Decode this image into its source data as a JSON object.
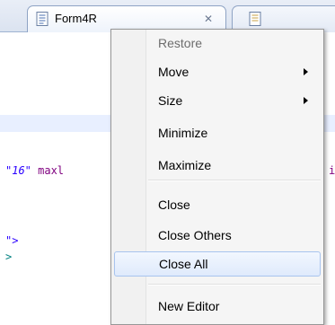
{
  "tabs": [
    {
      "label": "Form4R",
      "icon": "file-icon",
      "close_glyph": "✕"
    },
    {
      "label": "",
      "icon": "file-icon"
    }
  ],
  "editor": {
    "line1": {
      "string": "\"16\"",
      "attr": " maxl",
      "tail": "i"
    },
    "line2": "\">",
    "line3": ">"
  },
  "context_menu": {
    "items": [
      {
        "label": "Restore",
        "enabled": false,
        "submenu": false
      },
      {
        "label": "Move",
        "enabled": true,
        "submenu": true
      },
      {
        "label": "Size",
        "enabled": true,
        "submenu": true
      },
      {
        "label": "Minimize",
        "enabled": true,
        "submenu": false
      },
      {
        "label": "Maximize",
        "enabled": true,
        "submenu": false
      },
      {
        "label": "Close",
        "enabled": true,
        "submenu": false
      },
      {
        "label": "Close Others",
        "enabled": true,
        "submenu": false
      },
      {
        "label": "Close All",
        "enabled": true,
        "submenu": false,
        "highlighted": true
      },
      {
        "label": "New Editor",
        "enabled": true,
        "submenu": false
      }
    ]
  },
  "colors": {
    "menu_bg": "#f5f5f5",
    "hover_border": "#a8c4ee",
    "string": "#2a00ff",
    "attribute": "#7f007f",
    "tag": "#008080",
    "current_line": "#e8efff"
  }
}
